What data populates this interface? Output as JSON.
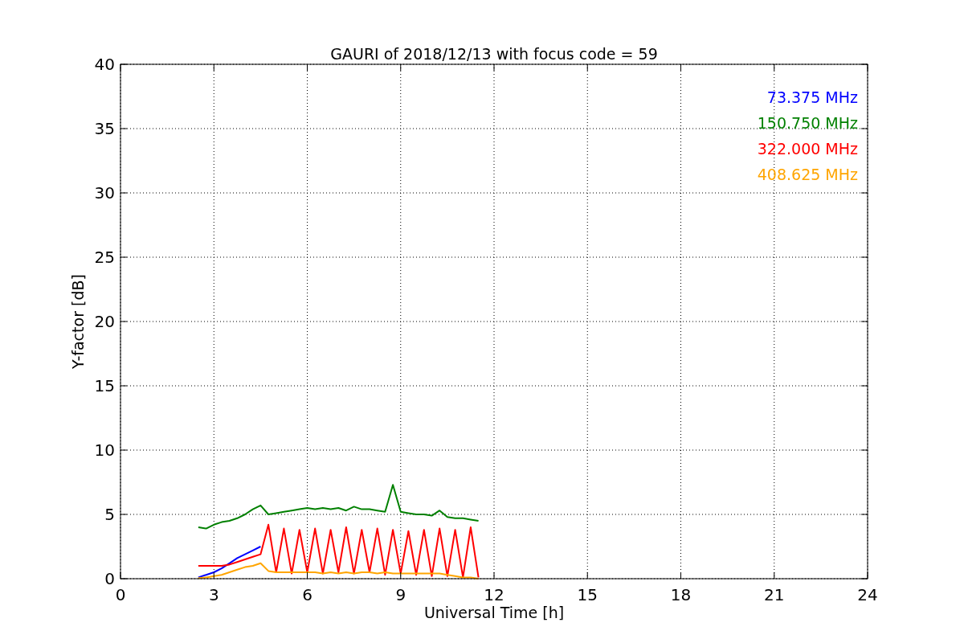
{
  "figure": {
    "chart_data": {
      "type": "line",
      "title": "GAURI of 2018/12/13 with focus code = 59",
      "xlabel": "Universal Time [h]",
      "ylabel": "Y-factor [dB]",
      "x": [
        2.5,
        2.75,
        3,
        3.25,
        3.5,
        3.75,
        4,
        4.25,
        4.5,
        4.75,
        5,
        5.25,
        5.5,
        5.75,
        6,
        6.25,
        6.5,
        6.75,
        7,
        7.25,
        7.5,
        7.75,
        8,
        8.25,
        8.5,
        8.75,
        9,
        9.25,
        9.5,
        9.75,
        10,
        10.25,
        10.5,
        10.75,
        11,
        11.25,
        11.5
      ],
      "series": [
        {
          "name": "73.375 MHz",
          "color": "#0000ff",
          "values": [
            0.1,
            0.3,
            0.5,
            0.8,
            1.2,
            1.6,
            1.9,
            2.2,
            2.5,
            null,
            null,
            null,
            null,
            null,
            null,
            null,
            null,
            null,
            null,
            null,
            null,
            null,
            null,
            null,
            null,
            null,
            null,
            null,
            null,
            null,
            null,
            null,
            null,
            null,
            null,
            null,
            null
          ]
        },
        {
          "name": "150.750 MHz",
          "color": "#008000",
          "values": [
            4.0,
            3.9,
            4.2,
            4.4,
            4.5,
            4.7,
            5.0,
            5.4,
            5.7,
            5.0,
            5.1,
            5.2,
            5.3,
            5.4,
            5.5,
            5.4,
            5.5,
            5.4,
            5.5,
            5.3,
            5.6,
            5.4,
            5.4,
            5.3,
            5.2,
            7.3,
            5.2,
            5.1,
            5.0,
            5.0,
            4.9,
            5.3,
            4.8,
            4.7,
            4.7,
            4.6,
            4.5
          ]
        },
        {
          "name": "322.000 MHz",
          "color": "#ff0000",
          "values": [
            1.0,
            1.0,
            1.0,
            1.0,
            1.1,
            1.3,
            1.5,
            1.7,
            1.9,
            4.2,
            0.5,
            3.9,
            0.4,
            3.8,
            0.5,
            3.9,
            0.4,
            3.8,
            0.5,
            4.0,
            0.4,
            3.8,
            0.5,
            3.9,
            0.3,
            3.8,
            0.4,
            3.7,
            0.3,
            3.8,
            0.2,
            3.9,
            0.2,
            3.8,
            0.1,
            4.0,
            0.1
          ]
        },
        {
          "name": "408.625 MHz",
          "color": "#ffa500",
          "values": [
            0.05,
            0.1,
            0.2,
            0.3,
            0.5,
            0.7,
            0.9,
            1.0,
            1.2,
            0.6,
            0.5,
            0.5,
            0.5,
            0.5,
            0.5,
            0.5,
            0.4,
            0.5,
            0.4,
            0.5,
            0.4,
            0.5,
            0.5,
            0.4,
            0.5,
            0.4,
            0.4,
            0.4,
            0.4,
            0.4,
            0.4,
            0.4,
            0.3,
            0.2,
            0.1,
            0.1,
            0.0
          ]
        }
      ],
      "grid": true,
      "xlim": [
        0,
        24
      ],
      "ylim": [
        0,
        40
      ],
      "xticks": [
        0,
        3,
        6,
        9,
        12,
        15,
        18,
        21,
        24
      ],
      "yticks": [
        0,
        5,
        10,
        15,
        20,
        25,
        30,
        35,
        40
      ]
    }
  }
}
